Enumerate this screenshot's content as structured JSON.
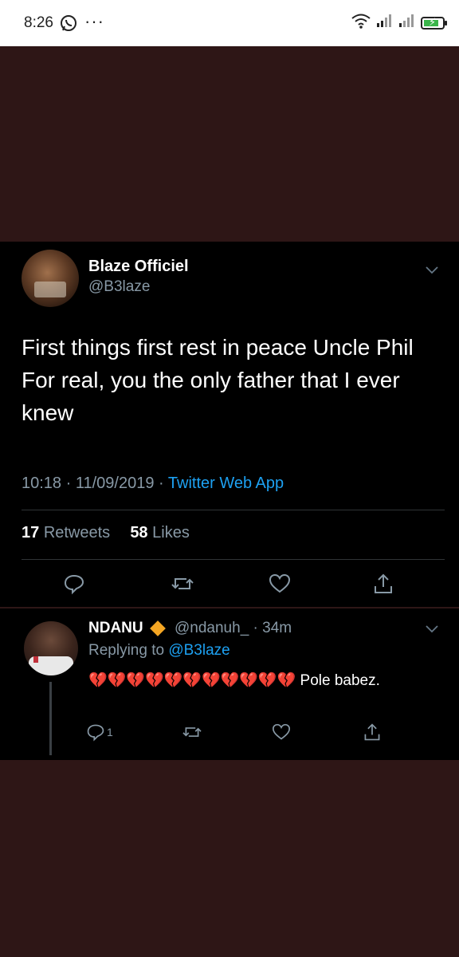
{
  "status_bar": {
    "time": "8:26",
    "dots": "···",
    "icons": [
      "whatsapp-icon",
      "wifi-icon",
      "signal-icon",
      "signal-icon-2",
      "battery-charging-icon"
    ]
  },
  "tweet": {
    "author_name": "Blaze Officiel",
    "author_handle": "@B3laze",
    "text": "First things first rest in peace Uncle Phil\nFor real, you the only father that I ever\nknew",
    "time": "10:18",
    "date": "11/09/2019",
    "source": "Twitter Web App",
    "retweets_count": "17",
    "retweets_label": "Retweets",
    "likes_count": "58",
    "likes_label": "Likes"
  },
  "reply": {
    "author_name": "NDANU",
    "author_handle": "@ndanuh_",
    "age": "34m",
    "replying_prefix": "Replying to",
    "replying_to": "@B3laze",
    "emoji_text": "💔💔💔💔💔💔💔💔💔💔💔",
    "text_after": "Pole babez.",
    "reply_count": "1"
  },
  "colors": {
    "accent_blue": "#1da1f2",
    "muted_text": "#8899a6",
    "background_maroon": "#2e1616",
    "verified_diamond": "#f5a623"
  }
}
